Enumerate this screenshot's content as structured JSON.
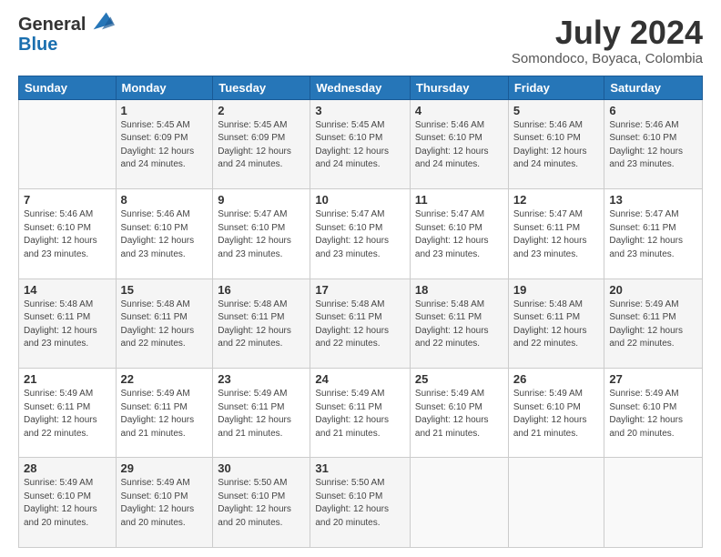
{
  "header": {
    "logo_general": "General",
    "logo_blue": "Blue",
    "month_title": "July 2024",
    "location": "Somondoco, Boyaca, Colombia"
  },
  "days_of_week": [
    "Sunday",
    "Monday",
    "Tuesday",
    "Wednesday",
    "Thursday",
    "Friday",
    "Saturday"
  ],
  "weeks": [
    [
      {
        "day": "",
        "info": ""
      },
      {
        "day": "1",
        "info": "Sunrise: 5:45 AM\nSunset: 6:09 PM\nDaylight: 12 hours\nand 24 minutes."
      },
      {
        "day": "2",
        "info": "Sunrise: 5:45 AM\nSunset: 6:09 PM\nDaylight: 12 hours\nand 24 minutes."
      },
      {
        "day": "3",
        "info": "Sunrise: 5:45 AM\nSunset: 6:10 PM\nDaylight: 12 hours\nand 24 minutes."
      },
      {
        "day": "4",
        "info": "Sunrise: 5:46 AM\nSunset: 6:10 PM\nDaylight: 12 hours\nand 24 minutes."
      },
      {
        "day": "5",
        "info": "Sunrise: 5:46 AM\nSunset: 6:10 PM\nDaylight: 12 hours\nand 24 minutes."
      },
      {
        "day": "6",
        "info": "Sunrise: 5:46 AM\nSunset: 6:10 PM\nDaylight: 12 hours\nand 23 minutes."
      }
    ],
    [
      {
        "day": "7",
        "info": "Sunrise: 5:46 AM\nSunset: 6:10 PM\nDaylight: 12 hours\nand 23 minutes."
      },
      {
        "day": "8",
        "info": "Sunrise: 5:46 AM\nSunset: 6:10 PM\nDaylight: 12 hours\nand 23 minutes."
      },
      {
        "day": "9",
        "info": "Sunrise: 5:47 AM\nSunset: 6:10 PM\nDaylight: 12 hours\nand 23 minutes."
      },
      {
        "day": "10",
        "info": "Sunrise: 5:47 AM\nSunset: 6:10 PM\nDaylight: 12 hours\nand 23 minutes."
      },
      {
        "day": "11",
        "info": "Sunrise: 5:47 AM\nSunset: 6:10 PM\nDaylight: 12 hours\nand 23 minutes."
      },
      {
        "day": "12",
        "info": "Sunrise: 5:47 AM\nSunset: 6:11 PM\nDaylight: 12 hours\nand 23 minutes."
      },
      {
        "day": "13",
        "info": "Sunrise: 5:47 AM\nSunset: 6:11 PM\nDaylight: 12 hours\nand 23 minutes."
      }
    ],
    [
      {
        "day": "14",
        "info": "Sunrise: 5:48 AM\nSunset: 6:11 PM\nDaylight: 12 hours\nand 23 minutes."
      },
      {
        "day": "15",
        "info": "Sunrise: 5:48 AM\nSunset: 6:11 PM\nDaylight: 12 hours\nand 22 minutes."
      },
      {
        "day": "16",
        "info": "Sunrise: 5:48 AM\nSunset: 6:11 PM\nDaylight: 12 hours\nand 22 minutes."
      },
      {
        "day": "17",
        "info": "Sunrise: 5:48 AM\nSunset: 6:11 PM\nDaylight: 12 hours\nand 22 minutes."
      },
      {
        "day": "18",
        "info": "Sunrise: 5:48 AM\nSunset: 6:11 PM\nDaylight: 12 hours\nand 22 minutes."
      },
      {
        "day": "19",
        "info": "Sunrise: 5:48 AM\nSunset: 6:11 PM\nDaylight: 12 hours\nand 22 minutes."
      },
      {
        "day": "20",
        "info": "Sunrise: 5:49 AM\nSunset: 6:11 PM\nDaylight: 12 hours\nand 22 minutes."
      }
    ],
    [
      {
        "day": "21",
        "info": "Sunrise: 5:49 AM\nSunset: 6:11 PM\nDaylight: 12 hours\nand 22 minutes."
      },
      {
        "day": "22",
        "info": "Sunrise: 5:49 AM\nSunset: 6:11 PM\nDaylight: 12 hours\nand 21 minutes."
      },
      {
        "day": "23",
        "info": "Sunrise: 5:49 AM\nSunset: 6:11 PM\nDaylight: 12 hours\nand 21 minutes."
      },
      {
        "day": "24",
        "info": "Sunrise: 5:49 AM\nSunset: 6:11 PM\nDaylight: 12 hours\nand 21 minutes."
      },
      {
        "day": "25",
        "info": "Sunrise: 5:49 AM\nSunset: 6:10 PM\nDaylight: 12 hours\nand 21 minutes."
      },
      {
        "day": "26",
        "info": "Sunrise: 5:49 AM\nSunset: 6:10 PM\nDaylight: 12 hours\nand 21 minutes."
      },
      {
        "day": "27",
        "info": "Sunrise: 5:49 AM\nSunset: 6:10 PM\nDaylight: 12 hours\nand 20 minutes."
      }
    ],
    [
      {
        "day": "28",
        "info": "Sunrise: 5:49 AM\nSunset: 6:10 PM\nDaylight: 12 hours\nand 20 minutes."
      },
      {
        "day": "29",
        "info": "Sunrise: 5:49 AM\nSunset: 6:10 PM\nDaylight: 12 hours\nand 20 minutes."
      },
      {
        "day": "30",
        "info": "Sunrise: 5:50 AM\nSunset: 6:10 PM\nDaylight: 12 hours\nand 20 minutes."
      },
      {
        "day": "31",
        "info": "Sunrise: 5:50 AM\nSunset: 6:10 PM\nDaylight: 12 hours\nand 20 minutes."
      },
      {
        "day": "",
        "info": ""
      },
      {
        "day": "",
        "info": ""
      },
      {
        "day": "",
        "info": ""
      }
    ]
  ]
}
